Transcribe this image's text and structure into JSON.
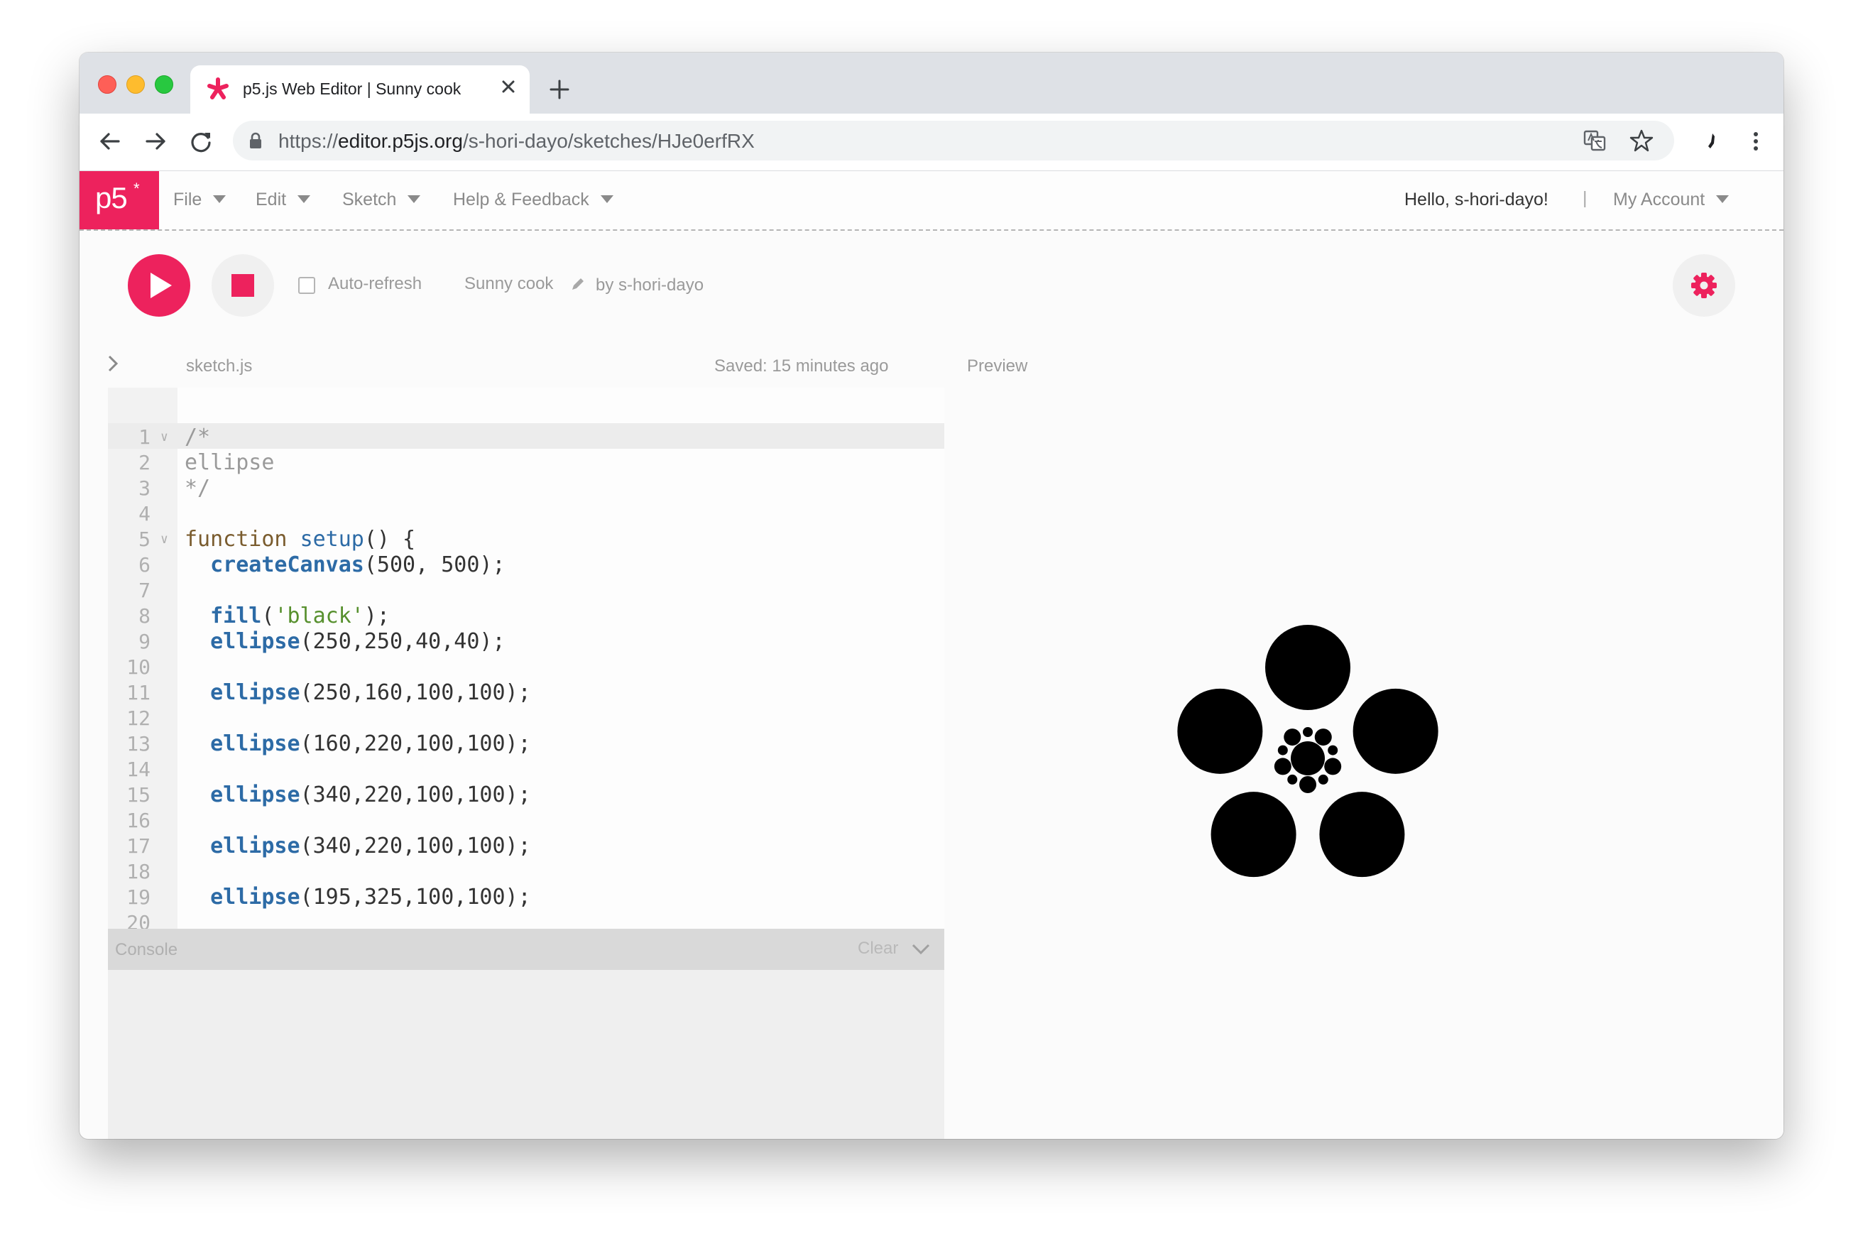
{
  "browser": {
    "tab_title": "p5.js Web Editor | Sunny cook",
    "url_prefix": "https://",
    "url_host": "editor.p5js.org",
    "url_path": "/s-hori-dayo/sketches/HJe0erfRX"
  },
  "header": {
    "logo": "p5",
    "logo_mark": "*",
    "menu": [
      "File",
      "Edit",
      "Sketch",
      "Help & Feedback"
    ],
    "greeting": "Hello, s-hori-dayo!",
    "separator": "|",
    "account": "My Account"
  },
  "toolbar": {
    "auto_refresh": "Auto-refresh",
    "sketch_name": "Sunny cook",
    "author": "by s-hori-dayo"
  },
  "editor": {
    "filename": "sketch.js",
    "saved": "Saved: 15 minutes ago",
    "preview_label": "Preview",
    "lines": [
      {
        "n": "1",
        "fold": true,
        "tokens": [
          {
            "t": "/*",
            "c": "comment"
          }
        ]
      },
      {
        "n": "2",
        "tokens": [
          {
            "t": "ellipse",
            "c": "comment"
          }
        ]
      },
      {
        "n": "3",
        "tokens": [
          {
            "t": "*/",
            "c": "comment"
          }
        ]
      },
      {
        "n": "4",
        "tokens": []
      },
      {
        "n": "5",
        "fold": true,
        "tokens": [
          {
            "t": "function",
            "c": "keyword"
          },
          {
            "t": " ",
            "c": ""
          },
          {
            "t": "setup",
            "c": "def"
          },
          {
            "t": "() {",
            "c": ""
          }
        ]
      },
      {
        "n": "6",
        "tokens": [
          {
            "t": "  ",
            "c": ""
          },
          {
            "t": "createCanvas",
            "c": "builtin"
          },
          {
            "t": "(500, 500);",
            "c": ""
          }
        ]
      },
      {
        "n": "7",
        "tokens": []
      },
      {
        "n": "8",
        "tokens": [
          {
            "t": "  ",
            "c": ""
          },
          {
            "t": "fill",
            "c": "builtin"
          },
          {
            "t": "(",
            "c": ""
          },
          {
            "t": "'black'",
            "c": "string"
          },
          {
            "t": ");",
            "c": ""
          }
        ]
      },
      {
        "n": "9",
        "tokens": [
          {
            "t": "  ",
            "c": ""
          },
          {
            "t": "ellipse",
            "c": "builtin"
          },
          {
            "t": "(250,250,40,40);",
            "c": ""
          }
        ]
      },
      {
        "n": "10",
        "tokens": []
      },
      {
        "n": "11",
        "tokens": [
          {
            "t": "  ",
            "c": ""
          },
          {
            "t": "ellipse",
            "c": "builtin"
          },
          {
            "t": "(250,160,100,100);",
            "c": ""
          }
        ]
      },
      {
        "n": "12",
        "tokens": []
      },
      {
        "n": "13",
        "tokens": [
          {
            "t": "  ",
            "c": ""
          },
          {
            "t": "ellipse",
            "c": "builtin"
          },
          {
            "t": "(160,220,100,100);",
            "c": ""
          }
        ]
      },
      {
        "n": "14",
        "tokens": []
      },
      {
        "n": "15",
        "tokens": [
          {
            "t": "  ",
            "c": ""
          },
          {
            "t": "ellipse",
            "c": "builtin"
          },
          {
            "t": "(340,220,100,100);",
            "c": ""
          }
        ]
      },
      {
        "n": "16",
        "tokens": []
      },
      {
        "n": "17",
        "tokens": [
          {
            "t": "  ",
            "c": ""
          },
          {
            "t": "ellipse",
            "c": "builtin"
          },
          {
            "t": "(340,220,100,100);",
            "c": ""
          }
        ]
      },
      {
        "n": "18",
        "tokens": []
      },
      {
        "n": "19",
        "tokens": [
          {
            "t": "  ",
            "c": ""
          },
          {
            "t": "ellipse",
            "c": "builtin"
          },
          {
            "t": "(195,325,100,100);",
            "c": ""
          }
        ]
      },
      {
        "n": "20",
        "tokens": []
      }
    ]
  },
  "console": {
    "label": "Console",
    "clear": "Clear"
  },
  "colors": {
    "accent": "#ed225d",
    "canvas_fill": "#000000"
  }
}
